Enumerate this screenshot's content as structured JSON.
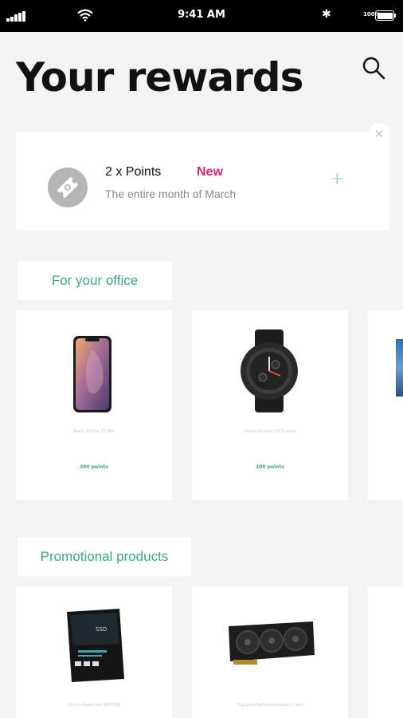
{
  "status_bar": {
    "time": "9:41 AM",
    "battery": "100%"
  },
  "header": {
    "title": "Your rewards"
  },
  "promo": {
    "title": "2 x Points",
    "badge": "New",
    "subtitle": "The entire month of March"
  },
  "sections": [
    {
      "label": "For your office",
      "items": [
        {
          "name": "Apple iPhone XS Max",
          "points": "300 points"
        },
        {
          "name": "Samsung Gear S3 Frontier",
          "points": "300 points"
        }
      ]
    },
    {
      "label": "Promotional products",
      "items": [
        {
          "name": "Silicon Power Ace A55 SSD",
          "points": ""
        },
        {
          "name": "Gigabyte GeForce Graphics Card",
          "points": ""
        }
      ]
    }
  ],
  "colors": {
    "accent": "#3aa58b",
    "badge": "#d4276f",
    "background": "#f2f3f4"
  }
}
